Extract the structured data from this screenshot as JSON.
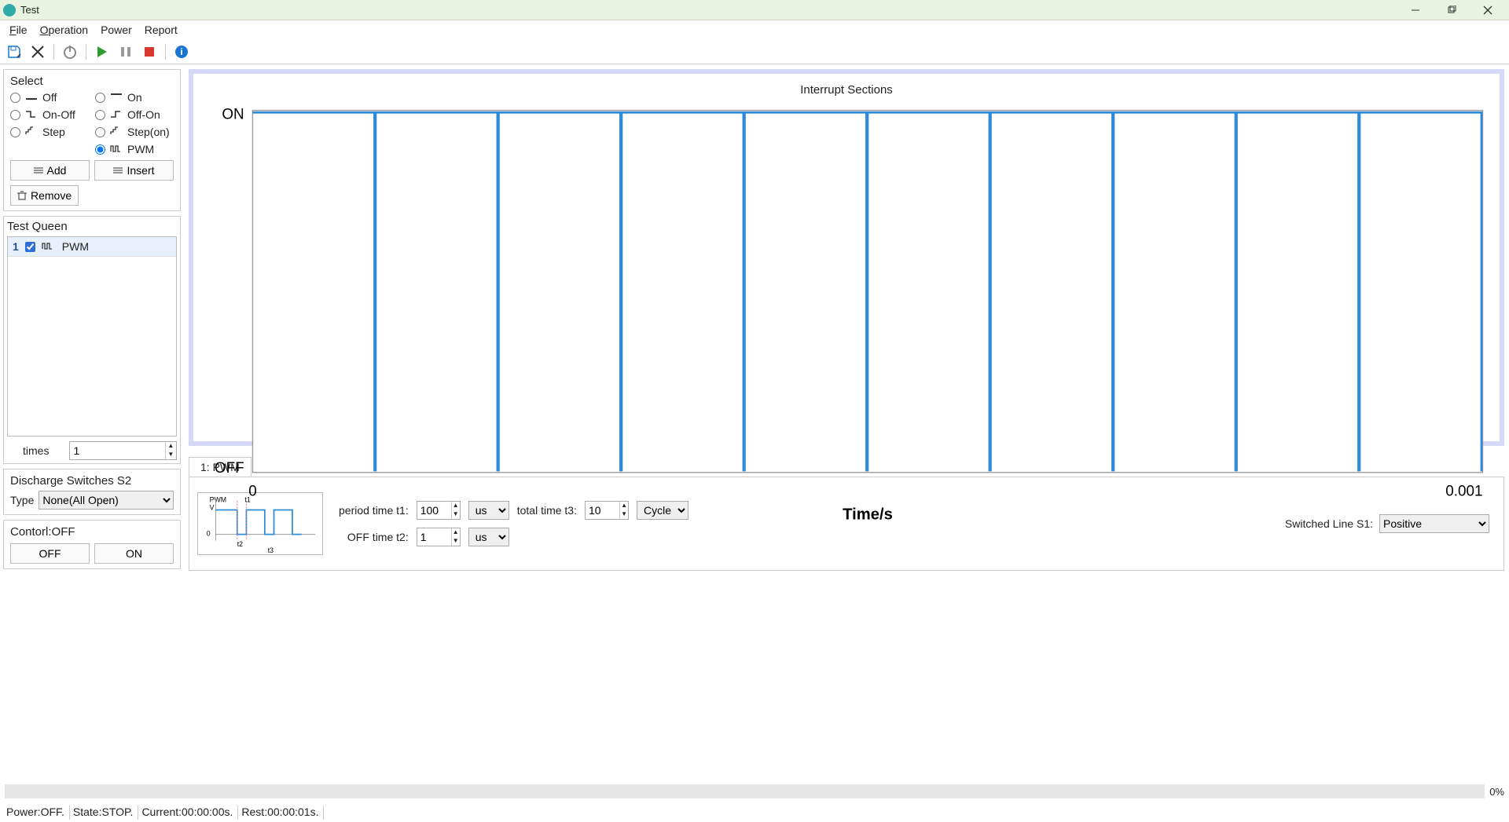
{
  "window": {
    "title": "Test"
  },
  "menu": {
    "file": "File",
    "operation": "Operation",
    "power": "Power",
    "report": "Report"
  },
  "select": {
    "title": "Select",
    "off": "Off",
    "on": "On",
    "onoff": "On-Off",
    "offon": "Off-On",
    "step": "Step",
    "stepon": "Step(on)",
    "pwm": "PWM",
    "selected": "pwm",
    "add": "Add",
    "insert": "Insert",
    "remove": "Remove"
  },
  "queue": {
    "title": "Test Queen",
    "items": [
      {
        "index": "1",
        "checked": true,
        "label": "PWM"
      }
    ],
    "times_label": "times",
    "times_value": "1"
  },
  "discharge": {
    "title": "Discharge Switches S2",
    "type_label": "Type",
    "type_value": "None(All  Open)"
  },
  "control": {
    "title": "Contorl:OFF",
    "off": "OFF",
    "on": "ON"
  },
  "chart": {
    "title": "Interrupt Sections"
  },
  "chart_data": {
    "type": "line",
    "title": "Interrupt Sections",
    "xlabel": "Time/s",
    "ylabel": "",
    "ytick_labels": [
      "OFF",
      "ON"
    ],
    "xlim": [
      0,
      0.001
    ],
    "cycles": 10,
    "period_s": 0.0001,
    "off_s": 1e-06,
    "series": [
      {
        "name": "PWM",
        "description": "Square wave: HIGH (ON) for 99us, LOW (OFF) for 1us, repeated 10 cycles over 0.001s",
        "y_high": "ON",
        "y_low": "OFF"
      }
    ]
  },
  "tab": {
    "label": "1: PWM"
  },
  "params": {
    "t1_label": "period time t1:",
    "t1_value": "100",
    "t1_unit": "us",
    "t2_label": "OFF time t2:",
    "t2_value": "1",
    "t2_unit": "us",
    "t3_label": "total time t3:",
    "t3_value": "10",
    "t3_unit": "Cycle",
    "thumb": {
      "pwm": "PWM",
      "v": "V",
      "zero": "0",
      "t1": "t1",
      "t2": "t2",
      "t3": "t3"
    }
  },
  "switched": {
    "label": "Switched Line S1:",
    "value": "Positive"
  },
  "progress": {
    "pct": "0%"
  },
  "status": {
    "power": "Power:OFF.",
    "state": "State:STOP.",
    "current": "Current:00:00:00s.",
    "rest": "Rest:00:00:01s."
  }
}
